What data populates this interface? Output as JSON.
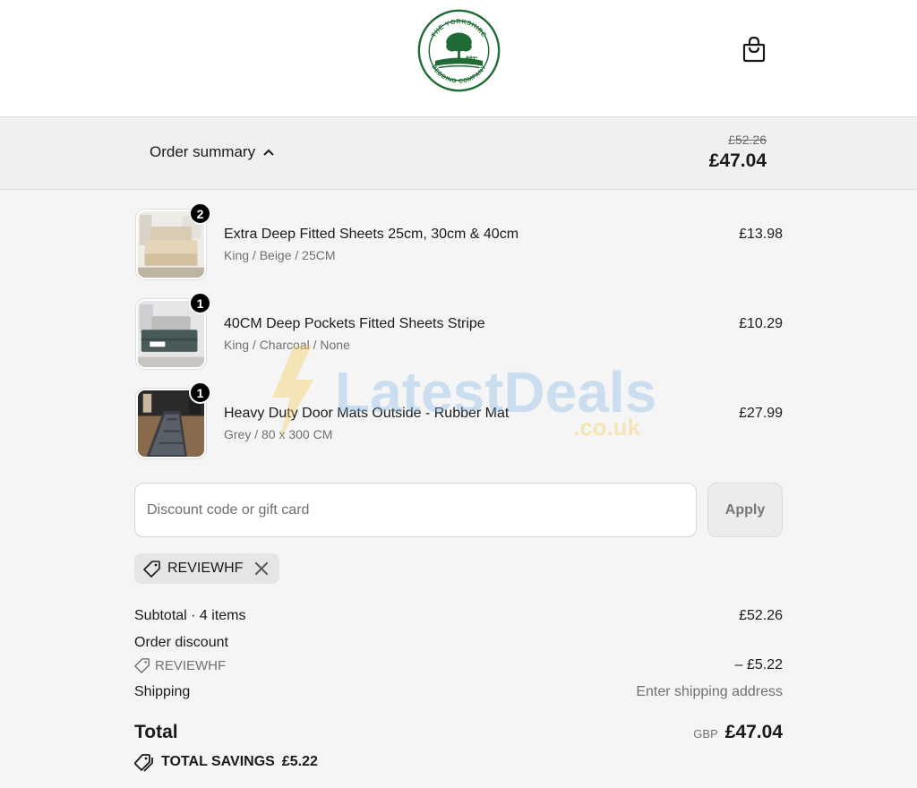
{
  "header": {
    "logo_lines": [
      "THE YORKSHIRE",
      "BEDDING COMPANY"
    ],
    "cart_icon": "shopping-bag-icon"
  },
  "summary": {
    "toggle_label": "Order summary",
    "toggle_icon": "chevron-up-icon",
    "original_price": "£52.26",
    "total_price": "£47.04"
  },
  "items": [
    {
      "quantity": "2",
      "title": "Extra Deep Fitted Sheets 25cm, 30cm & 40cm",
      "variant": "King / Beige / 25CM",
      "price": "£13.98"
    },
    {
      "quantity": "1",
      "title": "40CM Deep Pockets Fitted Sheets Stripe",
      "variant": "King / Charcoal / None",
      "price": "£10.29"
    },
    {
      "quantity": "1",
      "title": "Heavy Duty Door Mats Outside - Rubber Mat",
      "variant": "Grey / 80 x 300 CM",
      "price": "£27.99"
    }
  ],
  "discount": {
    "placeholder": "Discount code or gift card",
    "value": "",
    "apply_label": "Apply",
    "applied_code": "REVIEWHF"
  },
  "totals": {
    "subtotal_label": "Subtotal · 4 items",
    "subtotal_value": "£52.26",
    "order_discount_label": "Order discount",
    "order_discount_code": "REVIEWHF",
    "order_discount_value": "– £5.22",
    "shipping_label": "Shipping",
    "shipping_value": "Enter shipping address",
    "total_label": "Total",
    "currency": "GBP",
    "total_value": "£47.04",
    "savings_label": "TOTAL SAVINGS",
    "savings_value": "£5.22"
  },
  "watermark": {
    "text": "LatestDeals",
    "subtext": ".co.uk"
  },
  "colors": {
    "brand_green": "#1f6b35",
    "badge": "#000000",
    "chip_bg": "#e5e5e5"
  }
}
